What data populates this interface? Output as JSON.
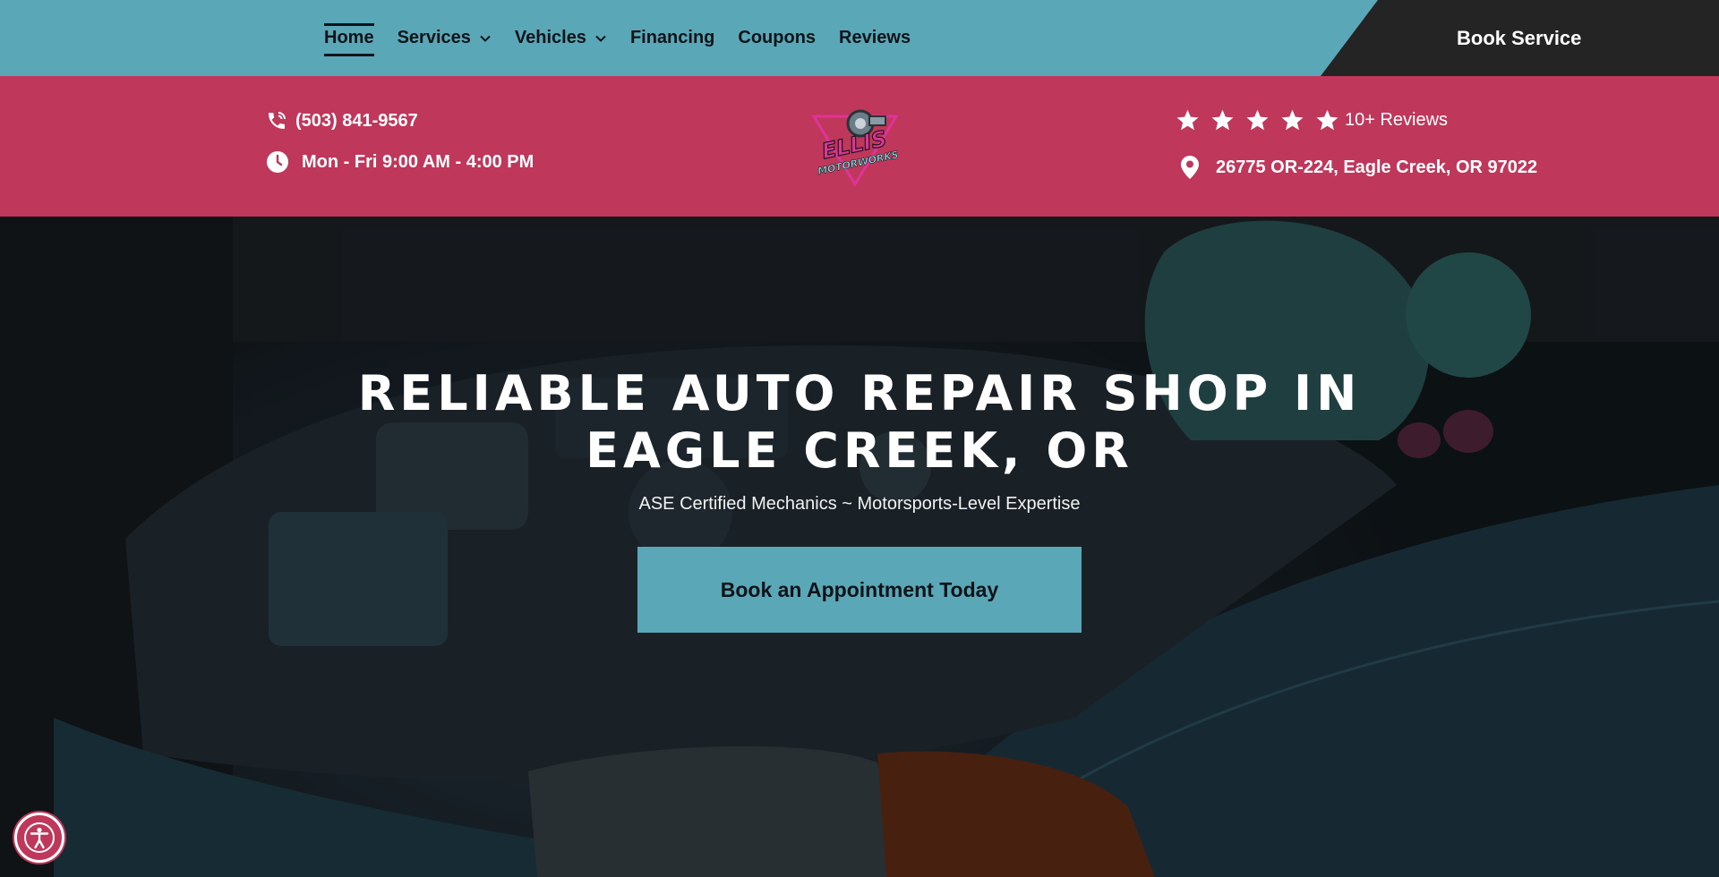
{
  "nav": {
    "items": [
      {
        "label": "Home",
        "active": true,
        "dropdown": false
      },
      {
        "label": "Services",
        "active": false,
        "dropdown": true
      },
      {
        "label": "Vehicles",
        "active": false,
        "dropdown": true
      },
      {
        "label": "Financing",
        "active": false,
        "dropdown": false
      },
      {
        "label": "Coupons",
        "active": false,
        "dropdown": false
      },
      {
        "label": "Reviews",
        "active": false,
        "dropdown": false
      }
    ],
    "book_label": "Book Service"
  },
  "info": {
    "phone": "(503) 841-9567",
    "hours": "Mon - Fri 9:00 AM - 4:00 PM",
    "rating_stars": 5,
    "reviews": "10+ Reviews",
    "address": "26775 OR-224, Eagle Creek, OR 97022"
  },
  "logo": {
    "line1": "ELLIS",
    "line2": "MOTORWORKS"
  },
  "hero": {
    "title_line1": "RELIABLE AUTO REPAIR SHOP IN",
    "title_line2": "EAGLE CREEK, OR",
    "subtitle": "ASE Certified Mechanics ~ Motorsports-Level Expertise",
    "cta": "Book an Appointment Today"
  },
  "colors": {
    "teal": "#5aa7b8",
    "pink": "#c0375c",
    "dark": "#242424",
    "text_dark": "#101418",
    "white": "#ffffff"
  },
  "icons": [
    "phone-icon",
    "clock-icon",
    "star-icon",
    "map-pin-icon",
    "chevron-down-icon",
    "accessibility-icon"
  ]
}
